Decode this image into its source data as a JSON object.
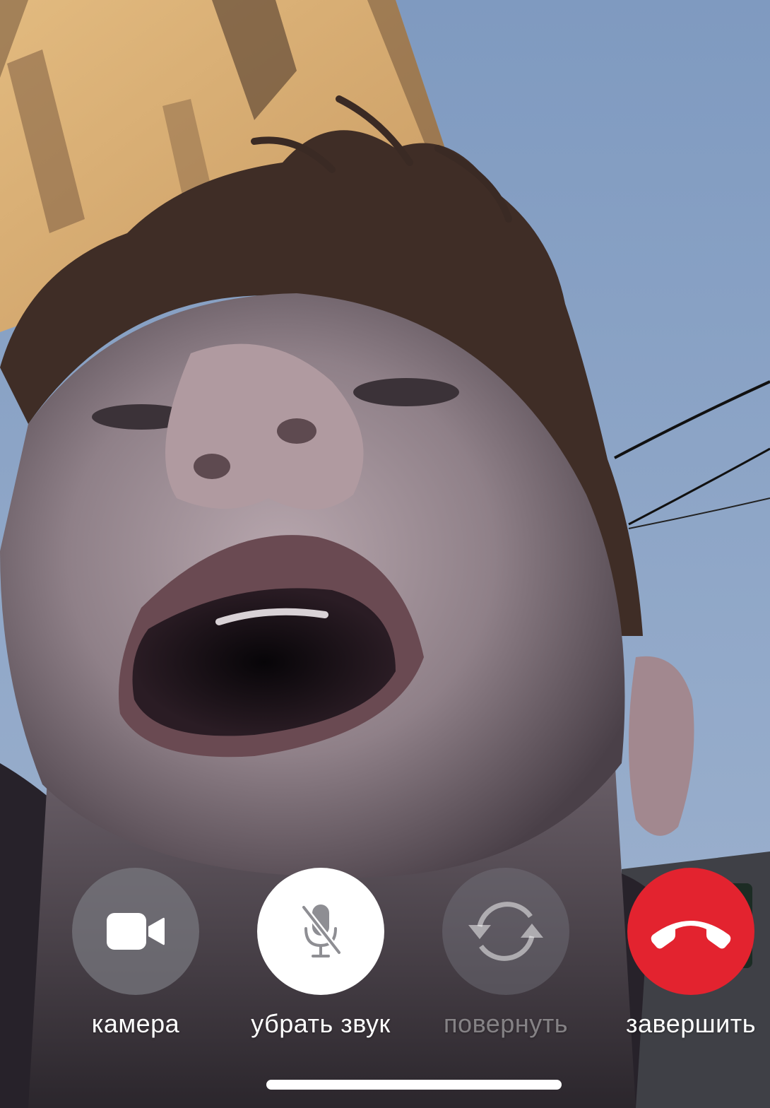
{
  "call": {
    "controls": [
      {
        "id": "camera",
        "label": "камера",
        "icon": "video-camera-icon",
        "state": "active"
      },
      {
        "id": "mute",
        "label": "убрать звук",
        "icon": "microphone-slash-icon",
        "state": "selected"
      },
      {
        "id": "flip",
        "label": "повернуть",
        "icon": "camera-flip-icon",
        "state": "disabled"
      },
      {
        "id": "end",
        "label": "завершить",
        "icon": "phone-hangup-icon",
        "state": "active"
      }
    ]
  },
  "colors": {
    "end_call": "#e3232f",
    "button_gray": "#78787f",
    "label": "#ffffff",
    "label_disabled": "#ffffff6b",
    "sky": "#8fa6c6",
    "building": "#e0b77c"
  }
}
